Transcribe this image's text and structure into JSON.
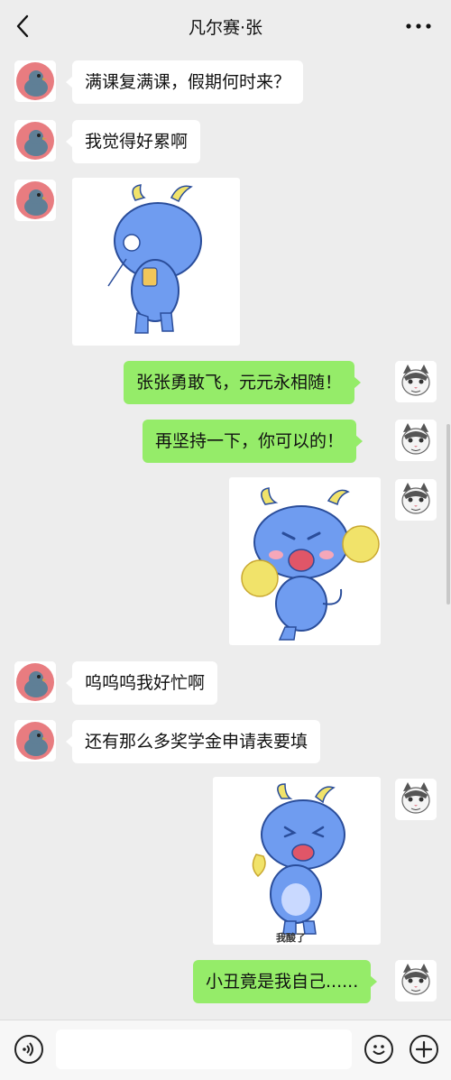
{
  "header": {
    "title": "凡尔赛·张"
  },
  "messages": {
    "m1": "满课复满课，假期何时来？",
    "m2": "我觉得好累啊",
    "m4": "张张勇敢飞，元元永相随！",
    "m5": "再坚持一下，你可以的！",
    "m7": "呜呜呜我好忙啊",
    "m8": "还有那么多奖学金申请表要填",
    "m10": "小丑竟是我自己......"
  },
  "stickers": {
    "s3": {
      "subject": "blue-dragon-walking-away"
    },
    "s6": {
      "subject": "blue-dragon-cheering-pompoms"
    },
    "s9": {
      "subject": "blue-dragon-crying-lemon",
      "caption": "我酸了"
    }
  },
  "icons": {
    "back": "chevron-left-icon",
    "more": "more-dots-icon",
    "voice": "voice-icon",
    "emoji": "emoji-icon",
    "plus": "plus-icon"
  },
  "colors": {
    "background": "#ededed",
    "incoming_bubble": "#ffffff",
    "outgoing_bubble": "#95ec69",
    "dragon": "#6f9cf0",
    "pompom": "#f1e36a"
  }
}
